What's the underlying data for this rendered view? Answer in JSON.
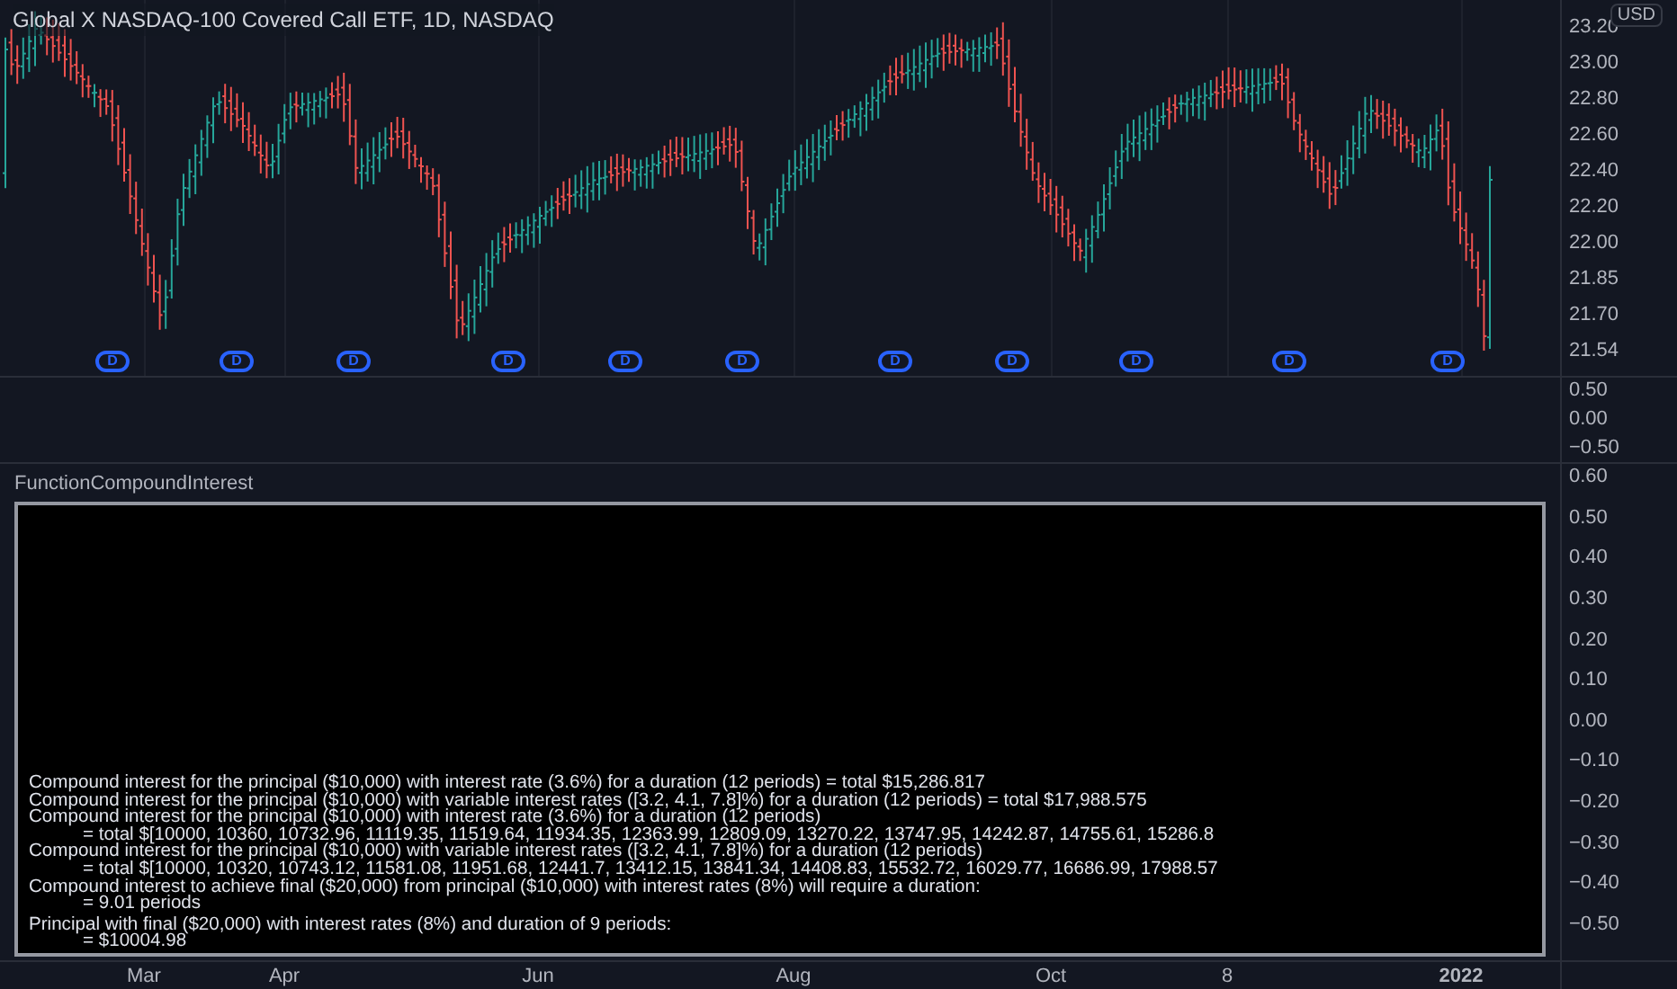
{
  "chart": {
    "title": "Global X NASDAQ-100 Covered Call ETF, 1D, NASDAQ",
    "currency": "USD",
    "price_axis": [
      "23.20",
      "23.00",
      "22.80",
      "22.60",
      "22.40",
      "22.20",
      "22.00",
      "21.85",
      "21.70",
      "21.54"
    ],
    "dividend_markers": [
      "D",
      "D",
      "D",
      "D",
      "D",
      "D",
      "D",
      "D",
      "D",
      "D",
      "D"
    ],
    "pane2_axis": [
      "0.50",
      "0.00",
      "−0.50"
    ],
    "time_axis": [
      {
        "label": "Mar",
        "bold": false
      },
      {
        "label": "Apr",
        "bold": false
      },
      {
        "label": "Jun",
        "bold": false
      },
      {
        "label": "Aug",
        "bold": false
      },
      {
        "label": "Oct",
        "bold": false
      },
      {
        "label": "8",
        "bold": false
      },
      {
        "label": "2022",
        "bold": true
      }
    ]
  },
  "indicator": {
    "name": "FunctionCompoundInterest",
    "axis": [
      "0.60",
      "0.50",
      "0.40",
      "0.30",
      "0.20",
      "0.10",
      "0.00",
      "−0.10",
      "−0.20",
      "−0.30",
      "−0.40",
      "−0.50"
    ],
    "lines": [
      {
        "text": "Compound interest for the principal ($10,000) with interest rate (3.6%) for a duration (12 periods) = total $15,286.817",
        "indent": false
      },
      {
        "text": "Compound interest for the principal ($10,000) with variable interest rates ([3.2, 4.1, 7.8]%) for a duration (12 periods) = total $17,988.575",
        "indent": false
      },
      {
        "text": "Compound interest for the principal ($10,000) with interest rate (3.6%) for a duration (12 periods)",
        "indent": false
      },
      {
        "text": "= total $[10000, 10360, 10732.96, 11119.35, 11519.64, 11934.35, 12363.99, 12809.09, 13270.22, 13747.95, 14242.87, 14755.61, 15286.8",
        "indent": true
      },
      {
        "text": "Compound interest for the principal ($10,000) with variable interest rates ([3.2, 4.1, 7.8]%) for a duration (12 periods)",
        "indent": false
      },
      {
        "text": "= total $[10000, 10320, 10743.12, 11581.08, 11951.68, 12441.7, 13412.15, 13841.34, 14408.83, 15532.72, 16029.77, 16686.99, 17988.57",
        "indent": true
      },
      {
        "text": "Compound interest to achieve final ($20,000) from principal ($10,000) with interest rates (8%) will require a duration:",
        "indent": false
      },
      {
        "text": "= 9.01 periods",
        "indent": true
      },
      {
        "text": "Principal with final ($20,000) with interest rates (8%) and duration of 9 periods:",
        "indent": false
      },
      {
        "text": "= $10004.98",
        "indent": true
      }
    ]
  }
}
